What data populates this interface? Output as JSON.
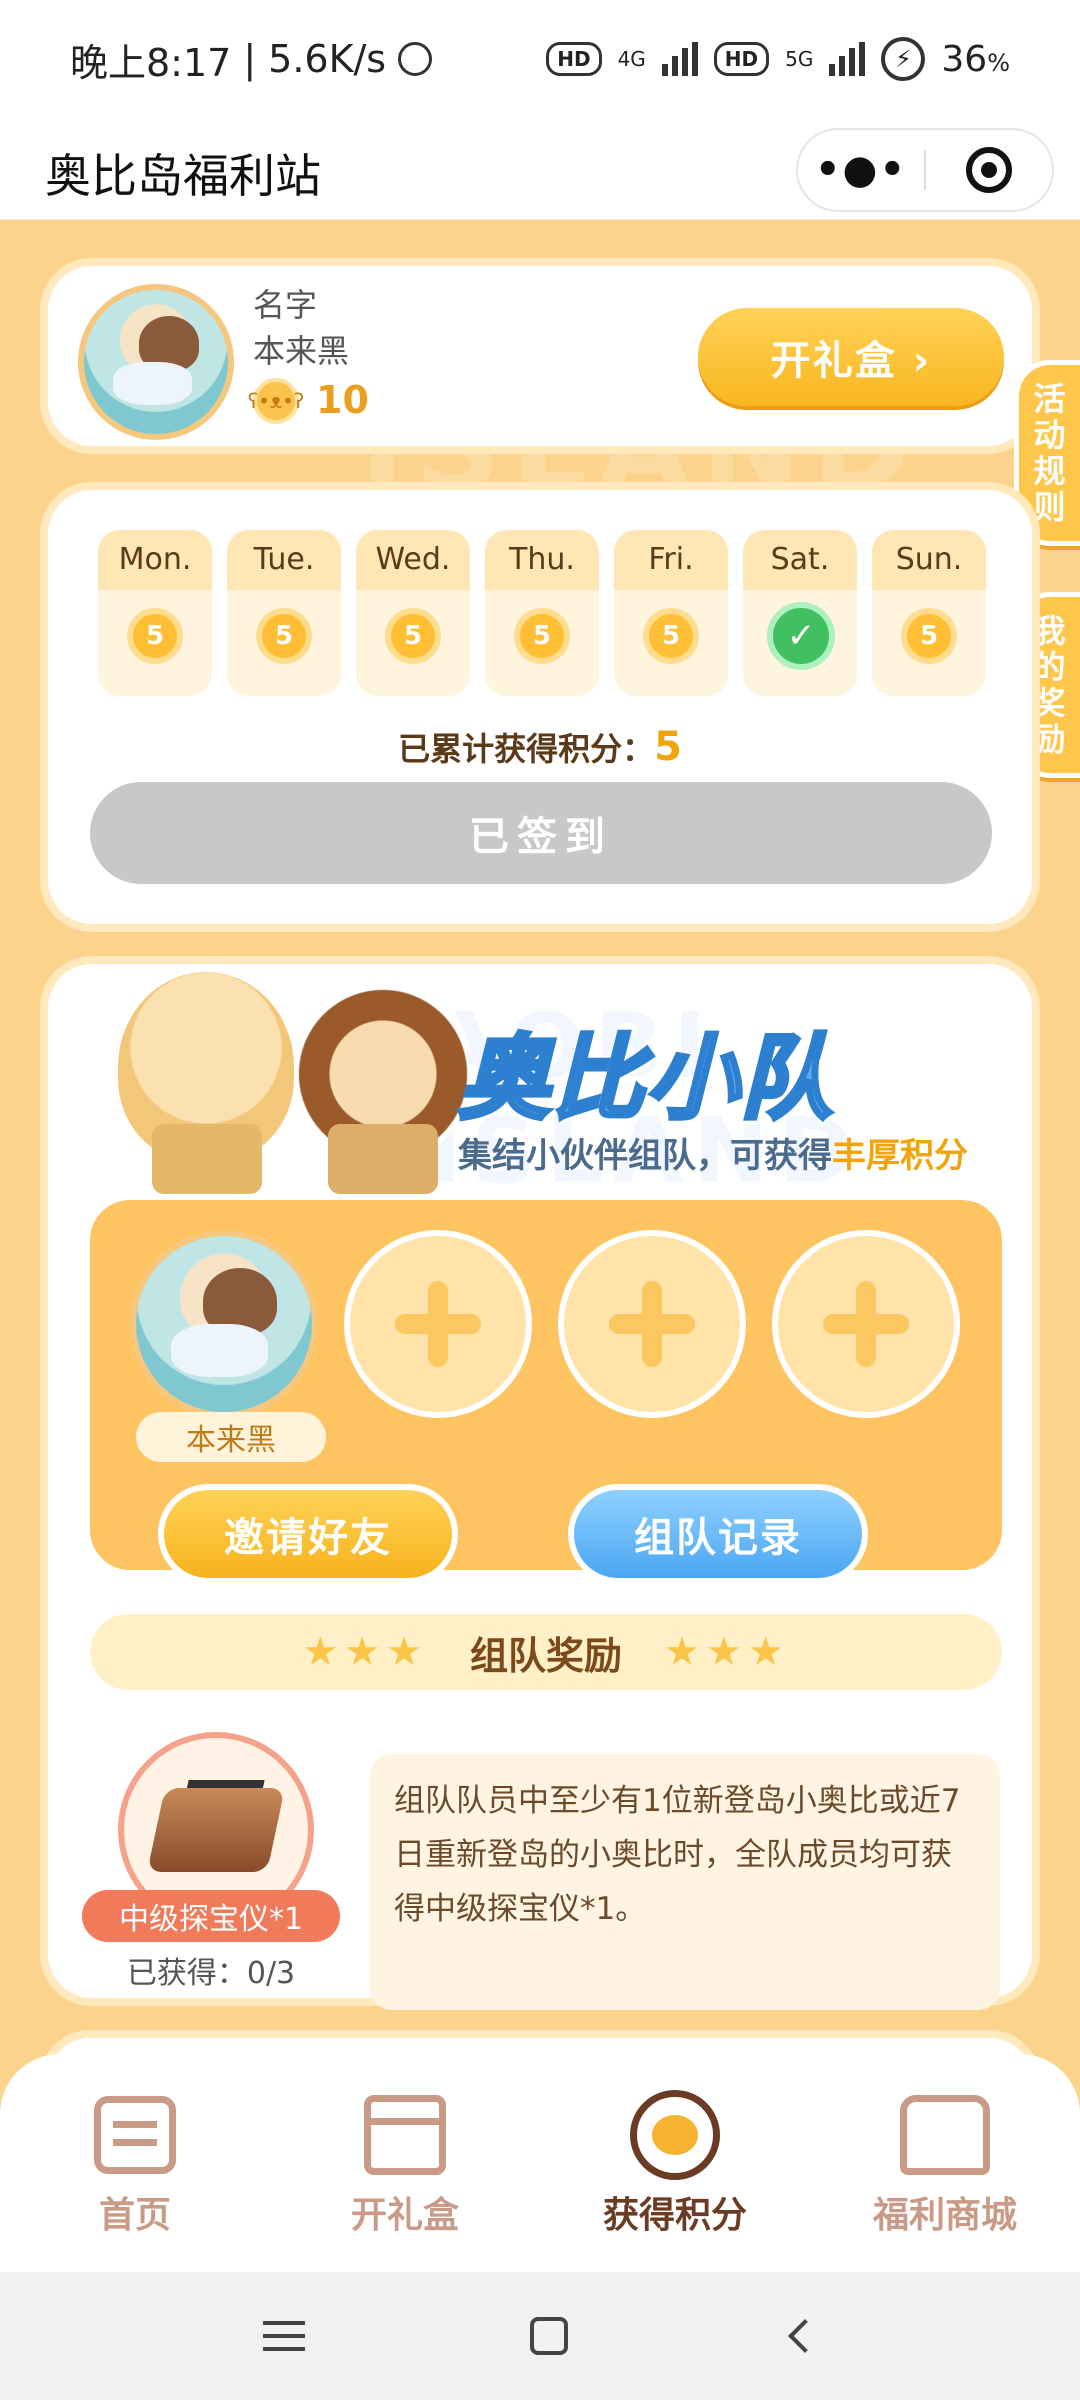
{
  "status_bar": {
    "time": "晚上8:17",
    "speed": "5.6K/s",
    "net1": "4G",
    "net2": "5G",
    "battery": "36",
    "battery_unit": "%"
  },
  "header": {
    "title": "奥比岛福利站",
    "more_icon": "more-dots-icon",
    "close_icon": "target-icon"
  },
  "profile": {
    "name_label": "名字",
    "name_value": "本来黑",
    "coins": "10",
    "open_box_button": "开礼盒 ›"
  },
  "side_tabs": {
    "rules": [
      "活",
      "动",
      "规",
      "则"
    ],
    "rewards": [
      "我",
      "的",
      "奖",
      "励"
    ]
  },
  "checkin": {
    "days": [
      {
        "name": "Mon.",
        "value": "5",
        "checked": false
      },
      {
        "name": "Tue.",
        "value": "5",
        "checked": false
      },
      {
        "name": "Wed.",
        "value": "5",
        "checked": false
      },
      {
        "name": "Thu.",
        "value": "5",
        "checked": false
      },
      {
        "name": "Fri.",
        "value": "5",
        "checked": false
      },
      {
        "name": "Sat.",
        "value": "✓",
        "checked": true
      },
      {
        "name": "Sun.",
        "value": "5",
        "checked": false
      }
    ],
    "total_label": "已累计获得积分：",
    "total_value": "5",
    "signed_button": "已签到"
  },
  "team": {
    "title": "奥比小队",
    "subtitle_prefix": "集结小伙伴组队，可获得",
    "subtitle_highlight": "丰厚积分",
    "member_name": "本来黑",
    "invite_button": "邀请好友",
    "record_button": "组队记录",
    "reward_title": "组队奖励",
    "reward_stars": "★★★",
    "reward_item": "中级探宝仪*1",
    "reward_progress": "已获得：0/3",
    "reward_desc": "组队队员中至少有1位新登岛小奥比或近7日重新登岛的小奥比时，全队成员均可获得中级探宝仪*1。"
  },
  "bottom_nav": [
    {
      "label": "首页",
      "icon": "calendar-icon",
      "active": false
    },
    {
      "label": "开礼盒",
      "icon": "gift-box-icon",
      "active": false
    },
    {
      "label": "获得积分",
      "icon": "bear-coin-icon",
      "active": true
    },
    {
      "label": "福利商城",
      "icon": "shop-icon",
      "active": false
    }
  ],
  "colors": {
    "background": "#fcd38c",
    "accent": "#f8b620",
    "blue": "#4ba6f2",
    "checked": "#40c060"
  }
}
